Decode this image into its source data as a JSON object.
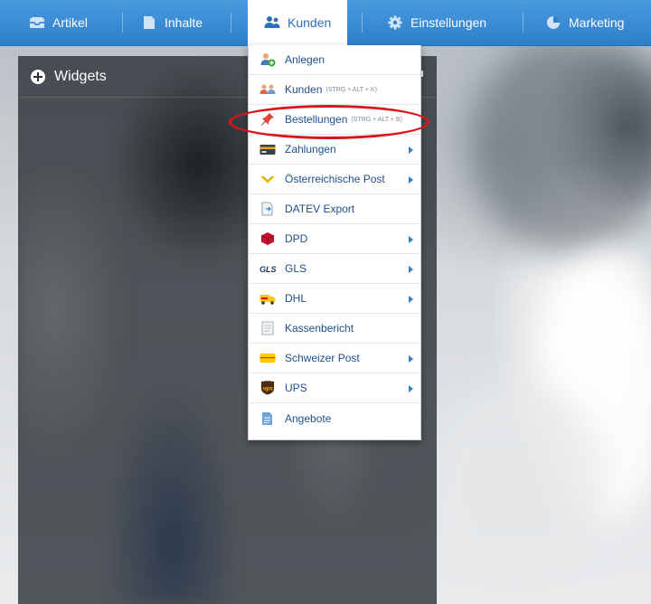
{
  "nav": {
    "items": [
      {
        "label": "Artikel",
        "icon": "inbox-icon"
      },
      {
        "label": "Inhalte",
        "icon": "document-icon"
      },
      {
        "label": "Kunden",
        "icon": "users-icon",
        "active": true
      },
      {
        "label": "Einstellungen",
        "icon": "gear-icon"
      },
      {
        "label": "Marketing",
        "icon": "pie-chart-icon"
      }
    ]
  },
  "widgets": {
    "title": "Widgets"
  },
  "menu": {
    "items": [
      {
        "label": "Anlegen",
        "icon": "add-user-icon"
      },
      {
        "label": "Kunden",
        "shortcut": "(STRG + ALT + K)",
        "icon": "customers-icon"
      },
      {
        "label": "Bestellungen",
        "shortcut": "(STRG + ALT + B)",
        "icon": "pin-icon",
        "highlighted": true
      },
      {
        "label": "Zahlungen",
        "icon": "payment-card-icon",
        "submenu": true
      },
      {
        "label": "Österreichische Post",
        "icon": "austrian-post-icon",
        "submenu": true
      },
      {
        "label": "DATEV Export",
        "icon": "export-document-icon"
      },
      {
        "label": "DPD",
        "icon": "dpd-cube-icon",
        "submenu": true
      },
      {
        "label": "GLS",
        "icon": "gls-logo-icon",
        "logo_text": "GLS",
        "submenu": true
      },
      {
        "label": "DHL",
        "icon": "dhl-truck-icon",
        "submenu": true
      },
      {
        "label": "Kassenbericht",
        "icon": "report-icon"
      },
      {
        "label": "Schweizer Post",
        "icon": "swiss-post-icon",
        "submenu": true
      },
      {
        "label": "UPS",
        "icon": "ups-shield-icon",
        "logo_text": "ups",
        "submenu": true
      },
      {
        "label": "Angebote",
        "icon": "offer-document-icon"
      }
    ]
  },
  "colors": {
    "navbar": "#2e7fca",
    "menu_text": "#1f4f8a",
    "highlight_ring": "#d9161c"
  }
}
